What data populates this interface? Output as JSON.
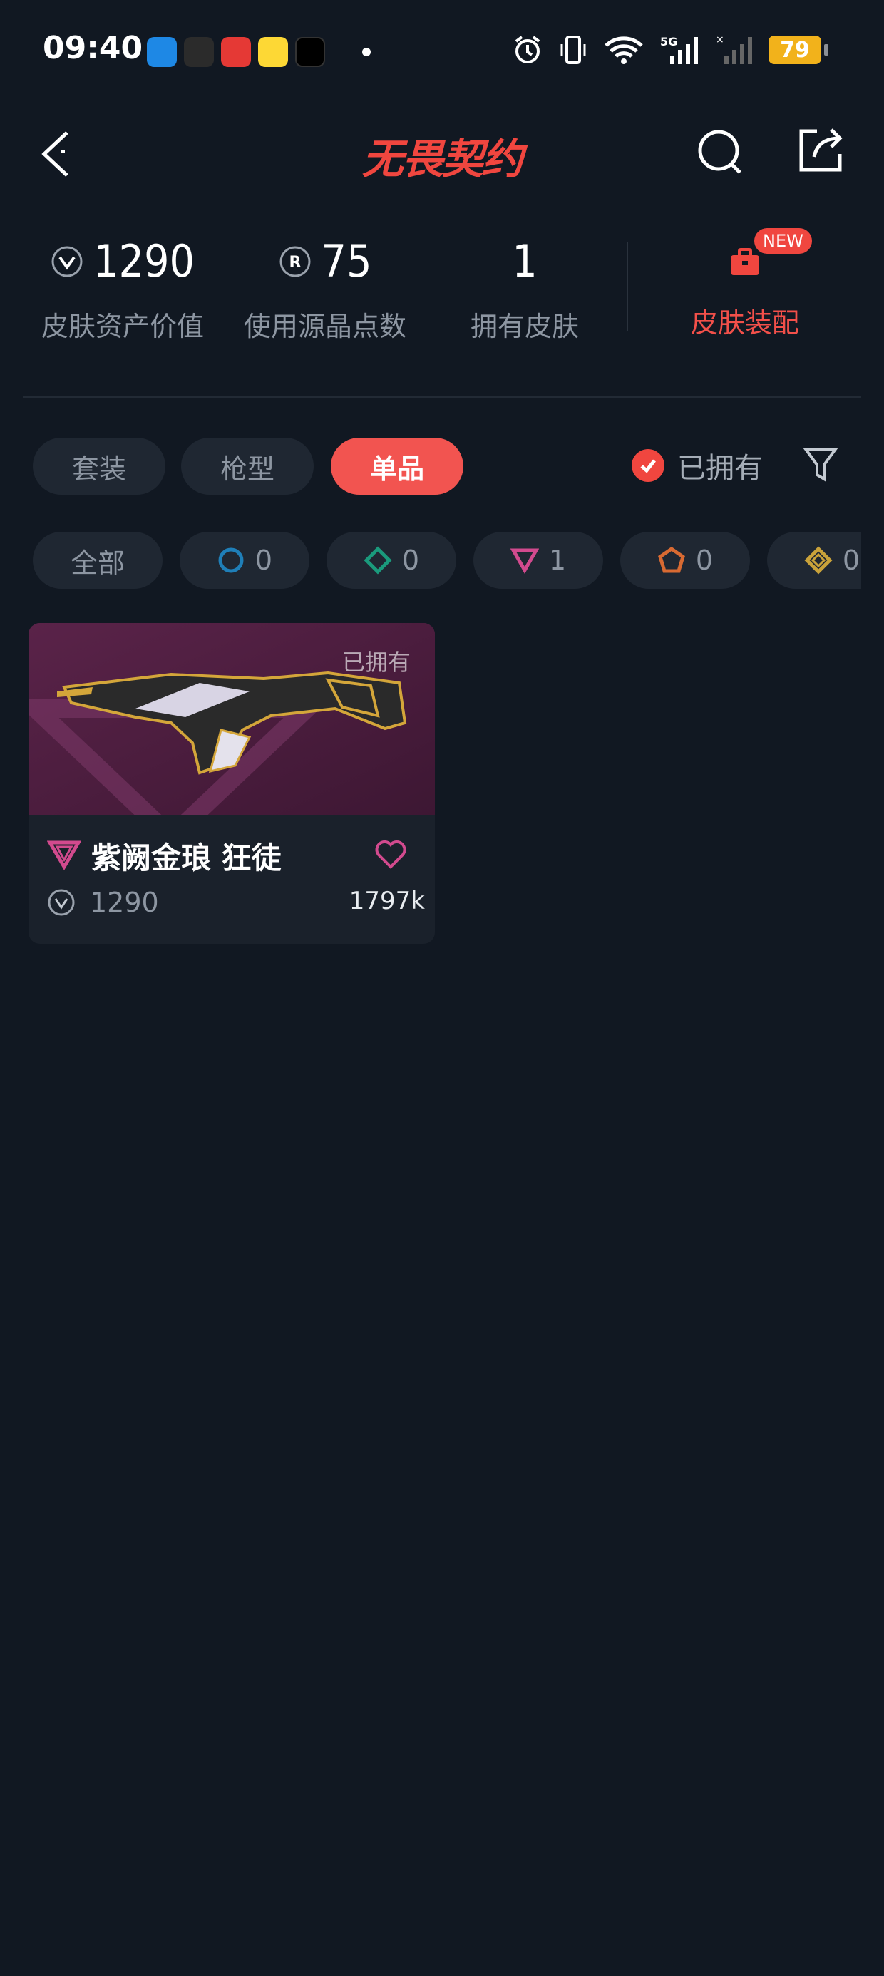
{
  "status_bar": {
    "time": "09:40",
    "battery": "79",
    "signal_label": "5G"
  },
  "header": {
    "logo_text": "无畏契约"
  },
  "stats": [
    {
      "value": "1290",
      "label": "皮肤资产价值"
    },
    {
      "value": "75",
      "label": "使用源晶点数"
    },
    {
      "value": "1",
      "label": "拥有皮肤"
    }
  ],
  "loadout": {
    "label": "皮肤装配",
    "badge": "NEW"
  },
  "tabs": [
    {
      "label": "套装",
      "active": false
    },
    {
      "label": "枪型",
      "active": false
    },
    {
      "label": "单品",
      "active": true
    }
  ],
  "owned_filter": {
    "label": "已拥有",
    "checked": true
  },
  "tier_chips": [
    {
      "label": "全部"
    },
    {
      "count": "0",
      "color": "#1f7fb8"
    },
    {
      "count": "0",
      "color": "#1a9a7c"
    },
    {
      "count": "1",
      "color": "#d24a8e"
    },
    {
      "count": "0",
      "color": "#d86a32"
    },
    {
      "count": "0",
      "color": "#c9a23a"
    }
  ],
  "items": [
    {
      "owned_tag": "已拥有",
      "name": "紫阙金琅 狂徒",
      "price": "1290",
      "likes": "1797k",
      "tier_color": "#d24a8e"
    }
  ],
  "colors": {
    "accent": "#f0463f",
    "background": "#111822",
    "chip_bg": "#1f2732"
  }
}
